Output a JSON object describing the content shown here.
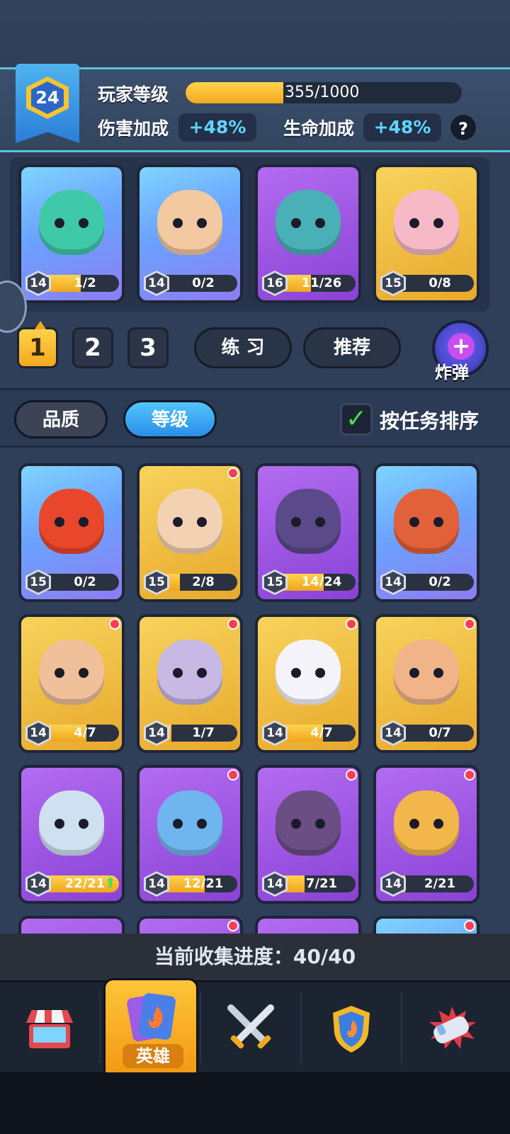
{
  "player": {
    "level": "24",
    "level_label": "玩家等级",
    "xp_text": "355/1000",
    "xp_fraction": 0.355,
    "damage_label": "伤害加成",
    "damage_value": "+48%",
    "hp_label": "生命加成",
    "hp_value": "+48%",
    "help": "?"
  },
  "lineup": [
    {
      "level": "14",
      "progress": "1/2",
      "fraction": 0.5,
      "rarity": "blue",
      "face": "#3fc9a8"
    },
    {
      "level": "14",
      "progress": "0/2",
      "fraction": 0.0,
      "rarity": "blue",
      "face": "#f2c9a0"
    },
    {
      "level": "16",
      "progress": "11/26",
      "fraction": 0.42,
      "rarity": "purple",
      "face": "#4ab0b8"
    },
    {
      "level": "15",
      "progress": "0/8",
      "fraction": 0.0,
      "rarity": "gold",
      "face": "#f6b9c6"
    }
  ],
  "teams": [
    "1",
    "2",
    "3"
  ],
  "actions": {
    "practice": "练 习",
    "recommend": "推荐",
    "bomb": "炸弹"
  },
  "filters": {
    "quality": "品质",
    "level": "等级",
    "sort_by_task": "按任务排序"
  },
  "heroes": [
    {
      "level": "15",
      "progress": "0/2",
      "fraction": 0.0,
      "rarity": "blue",
      "face": "#e8472c",
      "dot": false
    },
    {
      "level": "15",
      "progress": "2/8",
      "fraction": 0.25,
      "rarity": "gold",
      "face": "#f3d2b4",
      "dot": true
    },
    {
      "level": "15",
      "progress": "14/24",
      "fraction": 0.58,
      "rarity": "purple",
      "face": "#5a4a8a",
      "dot": false
    },
    {
      "level": "14",
      "progress": "0/2",
      "fraction": 0.0,
      "rarity": "blue",
      "face": "#e0613a",
      "dot": false
    },
    {
      "level": "14",
      "progress": "4/7",
      "fraction": 0.57,
      "rarity": "gold",
      "face": "#f0c09a",
      "dot": true
    },
    {
      "level": "14",
      "progress": "1/7",
      "fraction": 0.14,
      "rarity": "gold",
      "face": "#c8b8e4",
      "dot": true
    },
    {
      "level": "14",
      "progress": "4/7",
      "fraction": 0.57,
      "rarity": "gold",
      "face": "#f4f4fa",
      "dot": true
    },
    {
      "level": "14",
      "progress": "0/7",
      "fraction": 0.0,
      "rarity": "gold",
      "face": "#f0b488",
      "dot": true
    },
    {
      "level": "14",
      "progress": "22/21",
      "fraction": 1.0,
      "rarity": "purple",
      "face": "#cfe1f0",
      "dot": false,
      "upgrade": true
    },
    {
      "level": "14",
      "progress": "12/21",
      "fraction": 0.57,
      "rarity": "purple",
      "face": "#6fb6ee",
      "dot": true
    },
    {
      "level": "14",
      "progress": "7/21",
      "fraction": 0.33,
      "rarity": "purple",
      "face": "#6a4e84",
      "dot": true
    },
    {
      "level": "14",
      "progress": "2/21",
      "fraction": 0.1,
      "rarity": "purple",
      "face": "#f2b64a",
      "dot": true
    },
    {
      "level": "",
      "progress": "",
      "fraction": 0.0,
      "rarity": "purple",
      "face": "#8a42d6",
      "dot": false
    },
    {
      "level": "",
      "progress": "",
      "fraction": 0.0,
      "rarity": "purple",
      "face": "#8a42d6",
      "dot": true
    },
    {
      "level": "",
      "progress": "",
      "fraction": 0.0,
      "rarity": "purple",
      "face": "#8a42d6",
      "dot": false
    },
    {
      "level": "",
      "progress": "",
      "fraction": 0.0,
      "rarity": "blue",
      "face": "#2a7ed8",
      "dot": true
    }
  ],
  "collection": {
    "text": "当前收集进度：40/40"
  },
  "nav": {
    "items": [
      {
        "name": "shop",
        "icon": "shop-icon"
      },
      {
        "name": "heroes",
        "icon": "hero-card-icon",
        "label": "英雄"
      },
      {
        "name": "battle",
        "icon": "crossed-swords-icon"
      },
      {
        "name": "guild",
        "icon": "shield-icon"
      },
      {
        "name": "events",
        "icon": "fist-icon"
      }
    ]
  },
  "colors": {
    "accent": "#f2a81e",
    "cyan": "#5fd6ff",
    "badge": "#ff3d52"
  }
}
